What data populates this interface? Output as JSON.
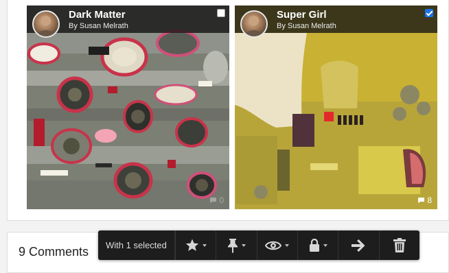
{
  "cards": [
    {
      "title": "Dark Matter",
      "byline": "By Susan Melrath",
      "checked": false,
      "comment_count": "0"
    },
    {
      "title": "Super Girl",
      "byline": "By Susan Melrath",
      "checked": true,
      "comment_count": "8"
    }
  ],
  "comments_section": {
    "title": "9 Comments"
  },
  "toolbar": {
    "selection_label": "With 1 selected",
    "actions": [
      {
        "icon": "star-icon",
        "has_dropdown": true
      },
      {
        "icon": "pin-icon",
        "has_dropdown": true
      },
      {
        "icon": "eye-icon",
        "has_dropdown": true
      },
      {
        "icon": "lock-icon",
        "has_dropdown": true
      },
      {
        "icon": "arrow-right-icon",
        "has_dropdown": false
      },
      {
        "icon": "trash-icon",
        "has_dropdown": false
      }
    ]
  },
  "colors": {
    "toolbar_bg": "#1d1d1d",
    "checkbox_checked": "#1a73e8",
    "header_overlay": "rgba(20,20,20,0.78)"
  }
}
